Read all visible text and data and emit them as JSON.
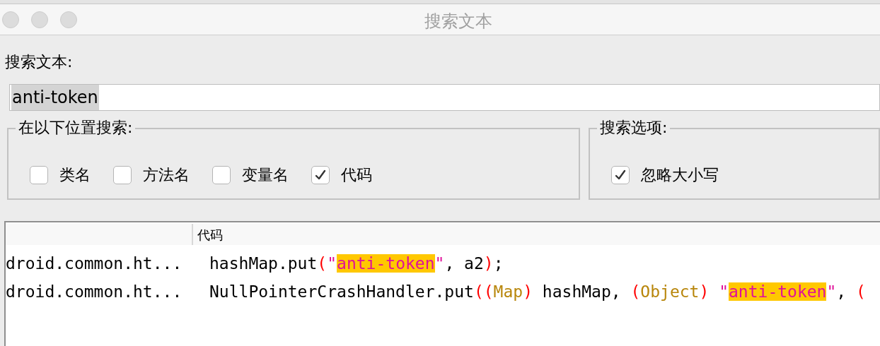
{
  "window": {
    "title": "搜索文本"
  },
  "search": {
    "label": "搜索文本:",
    "value": "anti-token",
    "value_selected": true
  },
  "location_group": {
    "title": "在以下位置搜索:",
    "options": [
      {
        "label": "类名",
        "checked": false
      },
      {
        "label": "方法名",
        "checked": false
      },
      {
        "label": "变量名",
        "checked": false
      },
      {
        "label": "代码",
        "checked": true
      }
    ]
  },
  "options_group": {
    "title": "搜索选项:",
    "options": [
      {
        "label": "忽略大小写",
        "checked": true
      }
    ]
  },
  "results": {
    "columns": [
      "代码"
    ],
    "rows": [
      {
        "column_1": "droid.common.ht...",
        "code": [
          {
            "kind": "plain",
            "text": "hashMap.put"
          },
          {
            "kind": "paren",
            "text": "("
          },
          {
            "kind": "quote",
            "text": "\""
          },
          {
            "kind": "match",
            "text": "anti-token"
          },
          {
            "kind": "quote",
            "text": "\""
          },
          {
            "kind": "plain",
            "text": ", a2"
          },
          {
            "kind": "paren",
            "text": ")"
          },
          {
            "kind": "plain",
            "text": ";"
          }
        ]
      },
      {
        "column_1": "droid.common.ht...",
        "code": [
          {
            "kind": "plain",
            "text": "NullPointerCrashHandler.put"
          },
          {
            "kind": "paren",
            "text": "("
          },
          {
            "kind": "paren",
            "text": "("
          },
          {
            "kind": "type",
            "text": "Map"
          },
          {
            "kind": "paren",
            "text": ")"
          },
          {
            "kind": "plain",
            "text": " hashMap, "
          },
          {
            "kind": "paren",
            "text": "("
          },
          {
            "kind": "type",
            "text": "Object"
          },
          {
            "kind": "paren",
            "text": ")"
          },
          {
            "kind": "quote",
            "text": " \""
          },
          {
            "kind": "match",
            "text": "anti-token"
          },
          {
            "kind": "quote",
            "text": "\""
          },
          {
            "kind": "plain",
            "text": ", "
          },
          {
            "kind": "paren",
            "text": "("
          }
        ]
      }
    ]
  }
}
